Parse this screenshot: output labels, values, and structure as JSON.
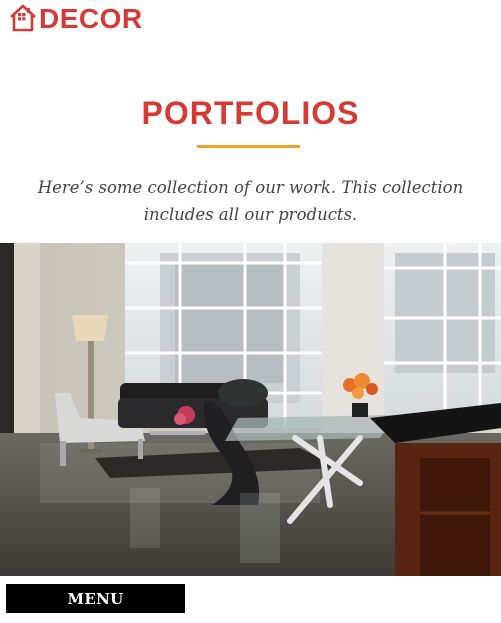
{
  "brand": {
    "name": "DECOR",
    "icon": "house-icon",
    "color": "#d63a35"
  },
  "section": {
    "title": "PORTFOLIOS",
    "accent_color": "#f0a323",
    "intro": "Here’s some collection of our work. This collection includes all our products."
  },
  "hero": {
    "alt": "Modern loft living room with black sofa, floor lamp, glass dining table and large windows"
  },
  "nav": {
    "menu_label": "MENU"
  }
}
